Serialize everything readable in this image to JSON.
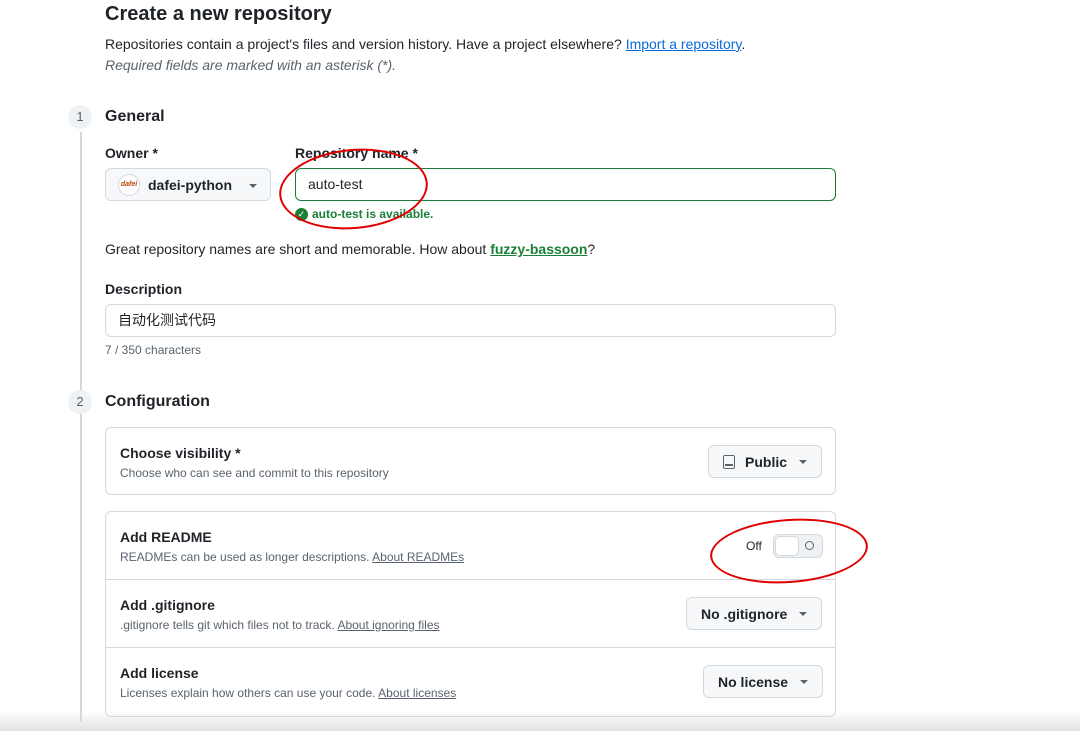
{
  "header": {
    "title": "Create a new repository",
    "intro_text": "Repositories contain a project's files and version history. Have a project elsewhere? ",
    "import_link": "Import a repository",
    "intro_end": ".",
    "required_note": "Required fields are marked with an asterisk (*)."
  },
  "general": {
    "step": "1",
    "title": "General",
    "owner_label": "Owner *",
    "owner_value": "dafei-python",
    "owner_avatar_text": "dafei",
    "repo_name_label": "Repository name *",
    "repo_name_value": "auto-test",
    "availability": "auto-test is available.",
    "suggestion_text": "Great repository names are short and memorable. How about ",
    "suggestion_link": "fuzzy-bassoon",
    "suggestion_end": "?",
    "description_label": "Description",
    "description_value": "自动化测试代码",
    "char_count": "7 / 350 characters"
  },
  "configuration": {
    "step": "2",
    "title": "Configuration",
    "visibility": {
      "title": "Choose visibility *",
      "desc": "Choose who can see and commit to this repository",
      "value": "Public"
    },
    "readme": {
      "title": "Add README",
      "desc": "READMEs can be used as longer descriptions. ",
      "link": "About READMEs",
      "toggle_label": "Off"
    },
    "gitignore": {
      "title": "Add .gitignore",
      "desc": ".gitignore tells git which files not to track. ",
      "link": "About ignoring files",
      "value": "No .gitignore"
    },
    "license": {
      "title": "Add license",
      "desc": "Licenses explain how others can use your code. ",
      "link": "About licenses",
      "value": "No license"
    }
  },
  "colors": {
    "success": "#1a7f37",
    "link": "#0969da",
    "annotation": "#e00000",
    "border": "#d1d9e0"
  }
}
